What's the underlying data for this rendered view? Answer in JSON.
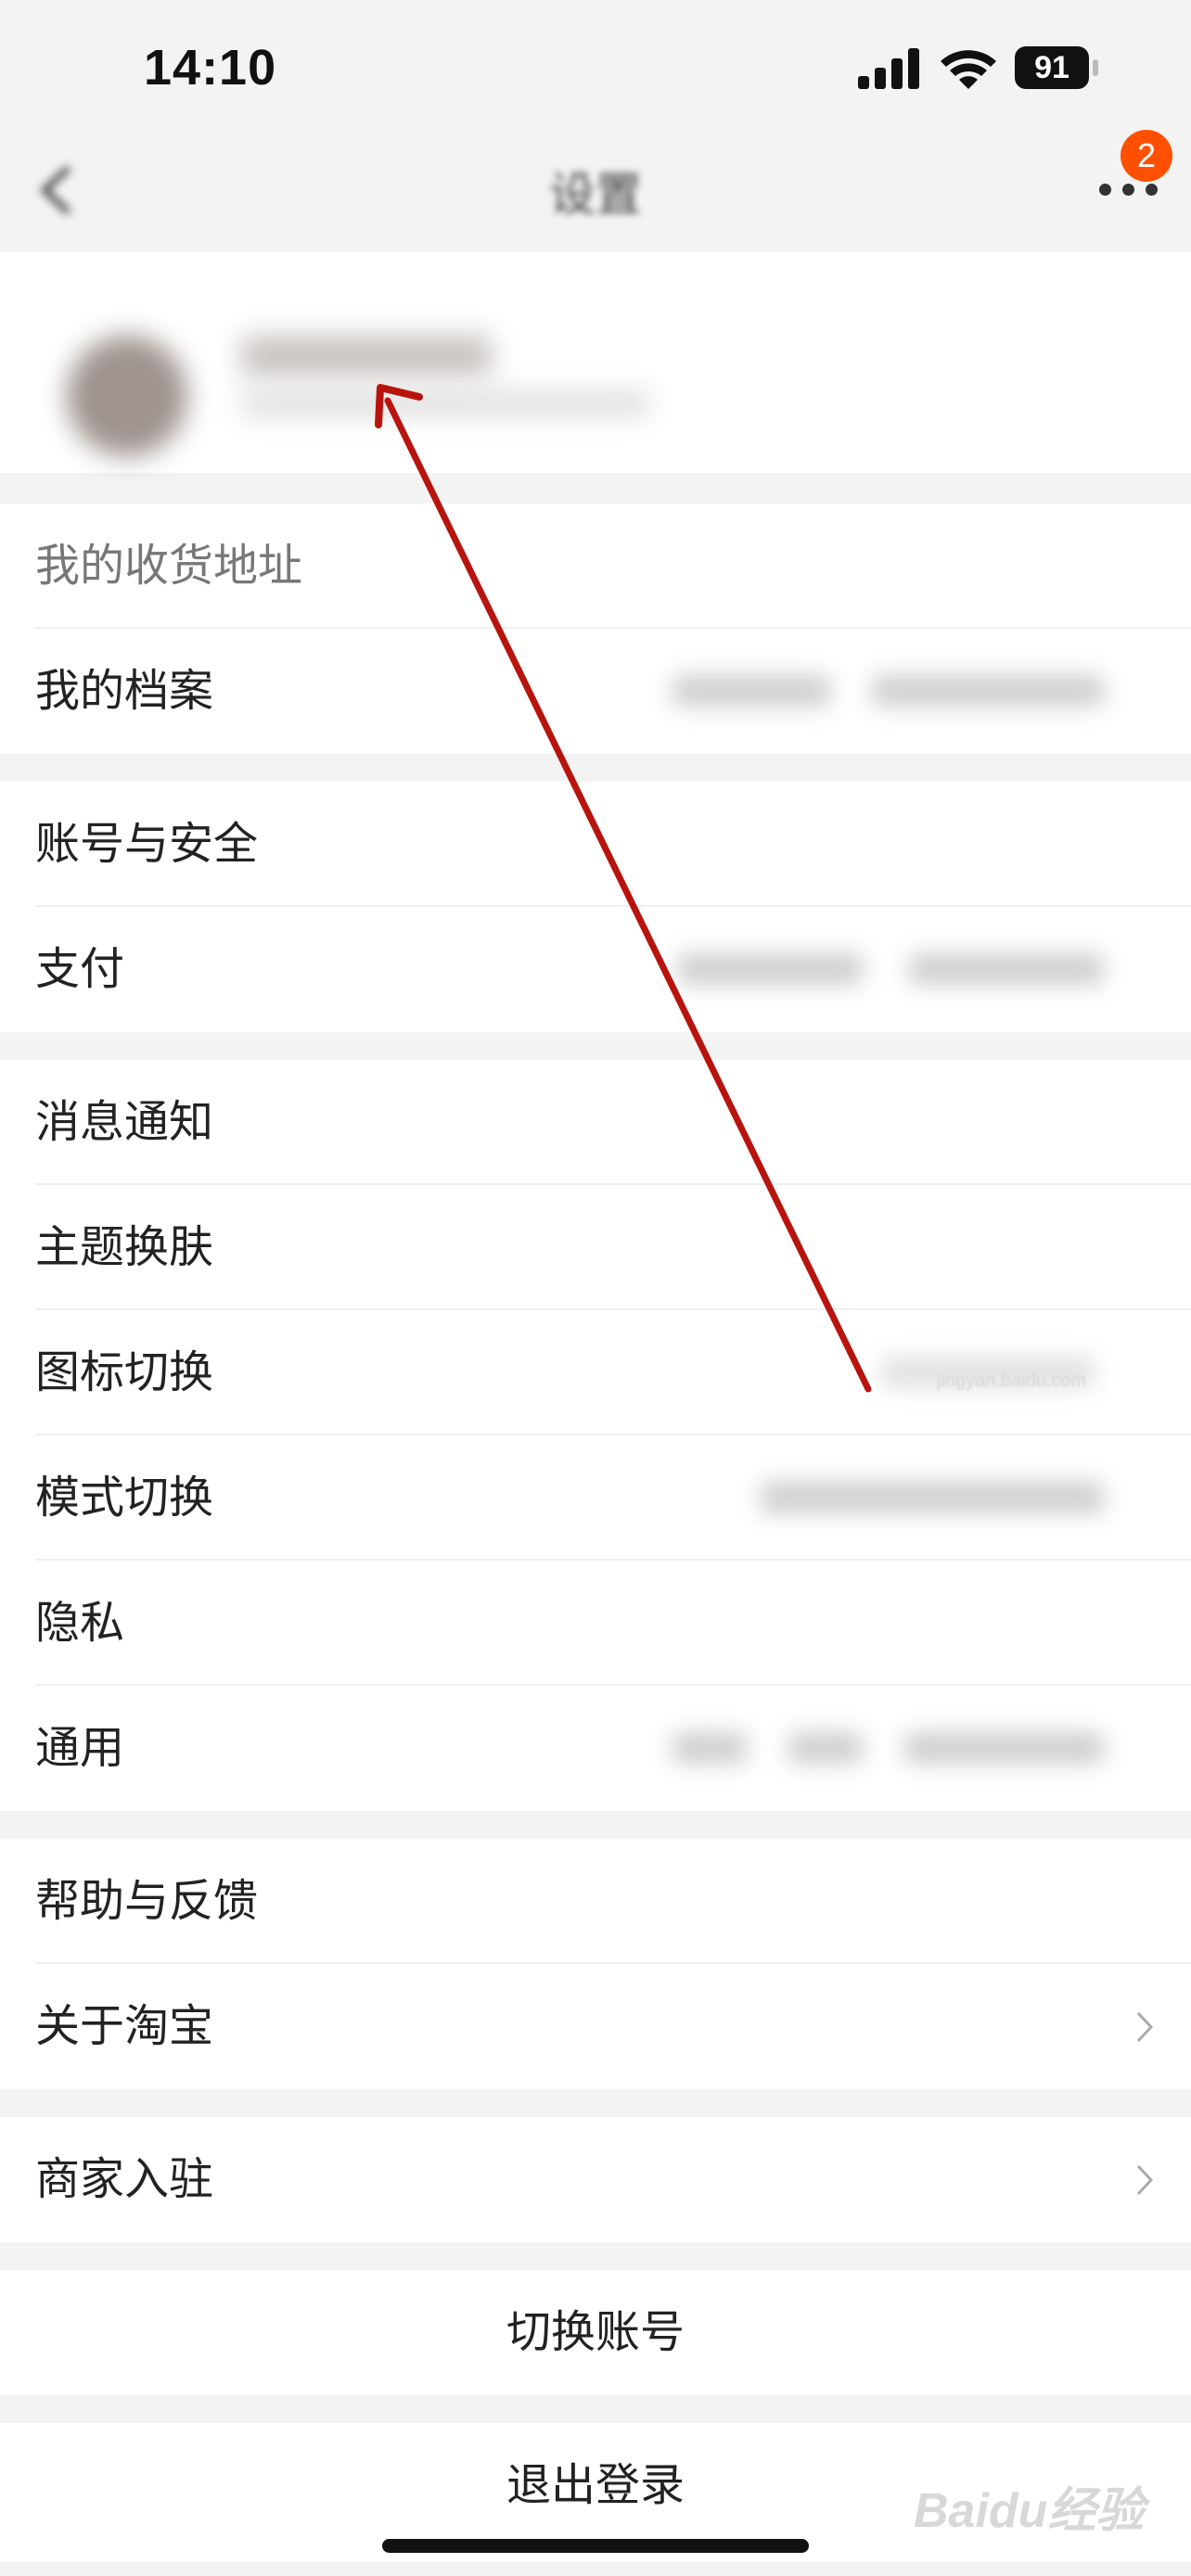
{
  "status_bar": {
    "time": "14:10",
    "battery": "91"
  },
  "nav": {
    "title": "设置",
    "badge_count": "2"
  },
  "menu": {
    "group1": [
      "我的收货地址",
      "我的档案"
    ],
    "group2": [
      "账号与安全",
      "支付"
    ],
    "group3": [
      "消息通知",
      "主题换肤",
      "图标切换",
      "模式切换",
      "隐私",
      "通用"
    ],
    "group4": [
      "帮助与反馈",
      "关于淘宝"
    ],
    "group5": [
      "商家入驻"
    ]
  },
  "actions": {
    "switch_account": "切换账号",
    "logout": "退出登录"
  },
  "watermark": {
    "brand": "Baidu经验",
    "url": "jingyan.baidu.com"
  },
  "colors": {
    "accent": "#ff5000",
    "arrow": "#b8140e"
  }
}
